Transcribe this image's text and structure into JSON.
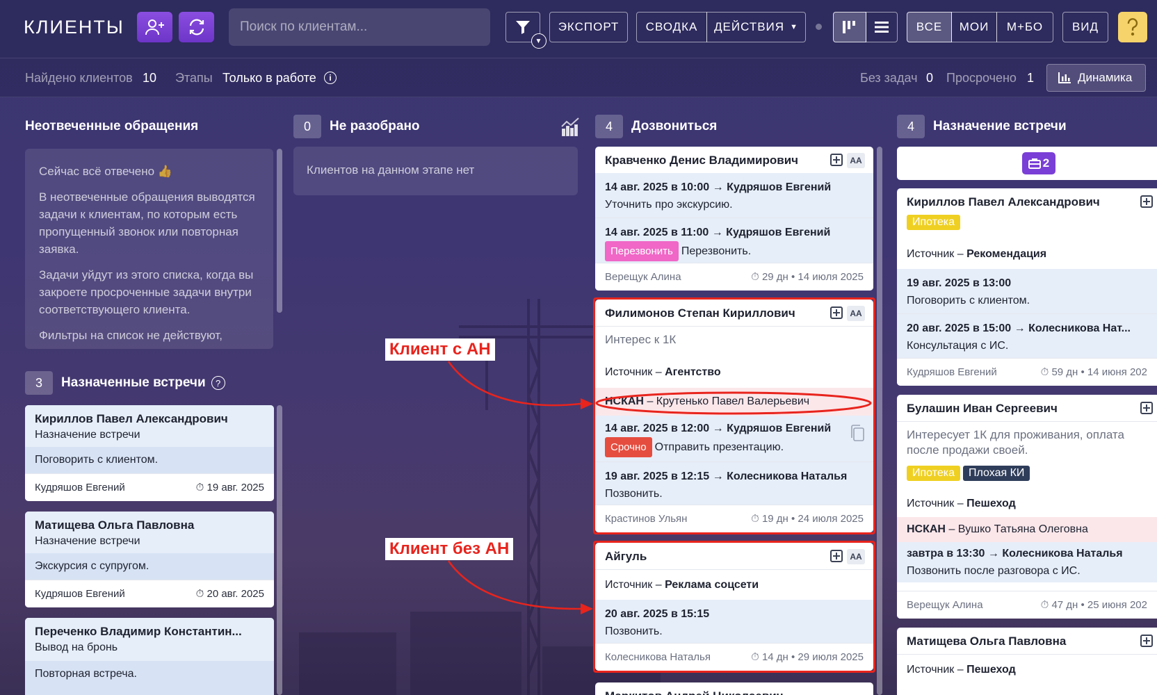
{
  "header": {
    "title": "КЛИЕНТЫ",
    "search_placeholder": "Поиск по клиентам...",
    "export_label": "ЭКСПОРТ",
    "summary_label": "СВОДКА",
    "actions_label": "ДЕЙСТВИЯ",
    "filter_all": "ВСЕ",
    "filter_mine": "МОИ",
    "filter_mbo": "М+БО",
    "view_label": "ВИД"
  },
  "subbar": {
    "found_label": "Найдено клиентов",
    "found_value": "10",
    "stages_label": "Этапы",
    "stages_value": "Только в работе",
    "no_tasks_label": "Без задач",
    "no_tasks_value": "0",
    "overdue_label": "Просрочено",
    "overdue_value": "1",
    "dynamics_label": "Динамика"
  },
  "col_unanswered": {
    "title": "Неотвеченные обращения",
    "p1": "Сейчас всё отвечено 👍",
    "p2": "В неотвеченные обращения выводятся задачи к клиентам, по которым есть пропущенный звонок или повторная заявка.",
    "p3": "Задачи уйдут из этого списка, когда вы закроете просроченные задачи внутри соответствующего клиента.",
    "p4": "Фильтры на список не действуют,"
  },
  "col_meetings": {
    "count": "3",
    "title": "Назначенные встречи",
    "cards": [
      {
        "name": "Кириллов Павел Александрович",
        "stage": "Назначение встречи",
        "task": "Поговорить с клиентом.",
        "manager": "Кудряшов Евгений",
        "date": "19 авг. 2025"
      },
      {
        "name": "Матищева Ольга Павловна",
        "stage": "Назначение встречи",
        "task": "Экскурсия с супругом.",
        "manager": "Кудряшов Евгений",
        "date": "20 авг. 2025"
      },
      {
        "name": "Переченко Владимир Константин...",
        "stage": "Вывод на бронь",
        "task": "Повторная встреча."
      }
    ]
  },
  "col_unsorted": {
    "count": "0",
    "title": "Не разобрано",
    "empty": "Клиентов на данном этапе нет"
  },
  "col_call": {
    "count": "4",
    "title": "Дозвониться",
    "aa": "AA",
    "c1": {
      "name": "Кравченко Денис Владимирович",
      "t1_head": "14 авг. 2025 в 10:00 → Кудряшов Евгений",
      "t1_text": "Уточнить про экскурсию.",
      "t2_head": "14 авг. 2025 в 11:00 → Кудряшов Евгений",
      "t2_tag": "Перезвонить",
      "t2_text": "Перезвонить.",
      "manager": "Верещук Алина",
      "age": "29 дн • 14 июля 2025"
    },
    "c2": {
      "name": "Филимонов Степан Кириллович",
      "interest": "Интерес к 1К",
      "source_label": "Источник –",
      "source": "Агентство",
      "agency_label": "НСКАН",
      "agency_person": "– Крутенько Павел Валерьевич",
      "t1_head": "14 авг. 2025 в 12:00 → Кудряшов Евгений",
      "t1_tag": "Срочно",
      "t1_text": "Отправить презентацию.",
      "t2_head": "19 авг. 2025 в 12:15 → Колесникова Наталья",
      "t2_text": "Позвонить.",
      "manager": "Крастинов Ульян",
      "age": "19 дн • 24 июля 2025"
    },
    "c3": {
      "name": "Айгуль",
      "source_label": "Источник –",
      "source": "Реклама соцсети",
      "t1_head": "20 авг. 2025 в 15:15",
      "t1_text": "Позвонить.",
      "manager": "Колесникова Наталья",
      "age": "14 дн • 29 июля 2025"
    },
    "c4_name": "Маркитов Андрей Николаевич"
  },
  "col_assign": {
    "count": "4",
    "title": "Назначение встречи",
    "badge": "2",
    "c1": {
      "name": "Кириллов Павел Александрович",
      "tag": "Ипотека",
      "source_label": "Источник –",
      "source": "Рекомендация",
      "t1_head": "19 авг. 2025 в 13:00",
      "t1_text": "Поговорить с клиентом.",
      "t2_head": "20 авг. 2025 в 15:00 → Колесникова Нат...",
      "t2_text": "Консультация с ИС.",
      "manager": "Кудряшов Евгений",
      "age": "59 дн • 14 июня 202"
    },
    "c2": {
      "name": "Булашин Иван Сергеевич",
      "interest": "Интересует 1К для проживания, оплата после продажи своей.",
      "tag1": "Ипотека",
      "tag2": "Плохая КИ",
      "source_label": "Источник –",
      "source": "Пешеход",
      "agency_label": "НСКАН",
      "agency_person": "– Вушко Татьяна Олеговна",
      "t1_head": "завтра в 13:30 → Колесникова Наталья",
      "t1_text": "Позвонить после разговора с ИС.",
      "manager": "Верещук Алина",
      "age": "47 дн • 25 июня 202"
    },
    "c3": {
      "name": "Матищева Ольга Павловна",
      "source_label": "Источник –",
      "source": "Пешеход"
    }
  },
  "annotations": {
    "with_agency": "Клиент с АН",
    "without_agency": "Клиент без АН"
  },
  "colors": {
    "accent_purple": "#7a3fd6",
    "highlight_red": "#e8241d",
    "tag_yellow": "#efd022",
    "tag_navy": "#2f3d5a",
    "tag_pink": "#f067c7",
    "tag_red": "#e54d3f",
    "help_yellow": "#f6d36b"
  }
}
